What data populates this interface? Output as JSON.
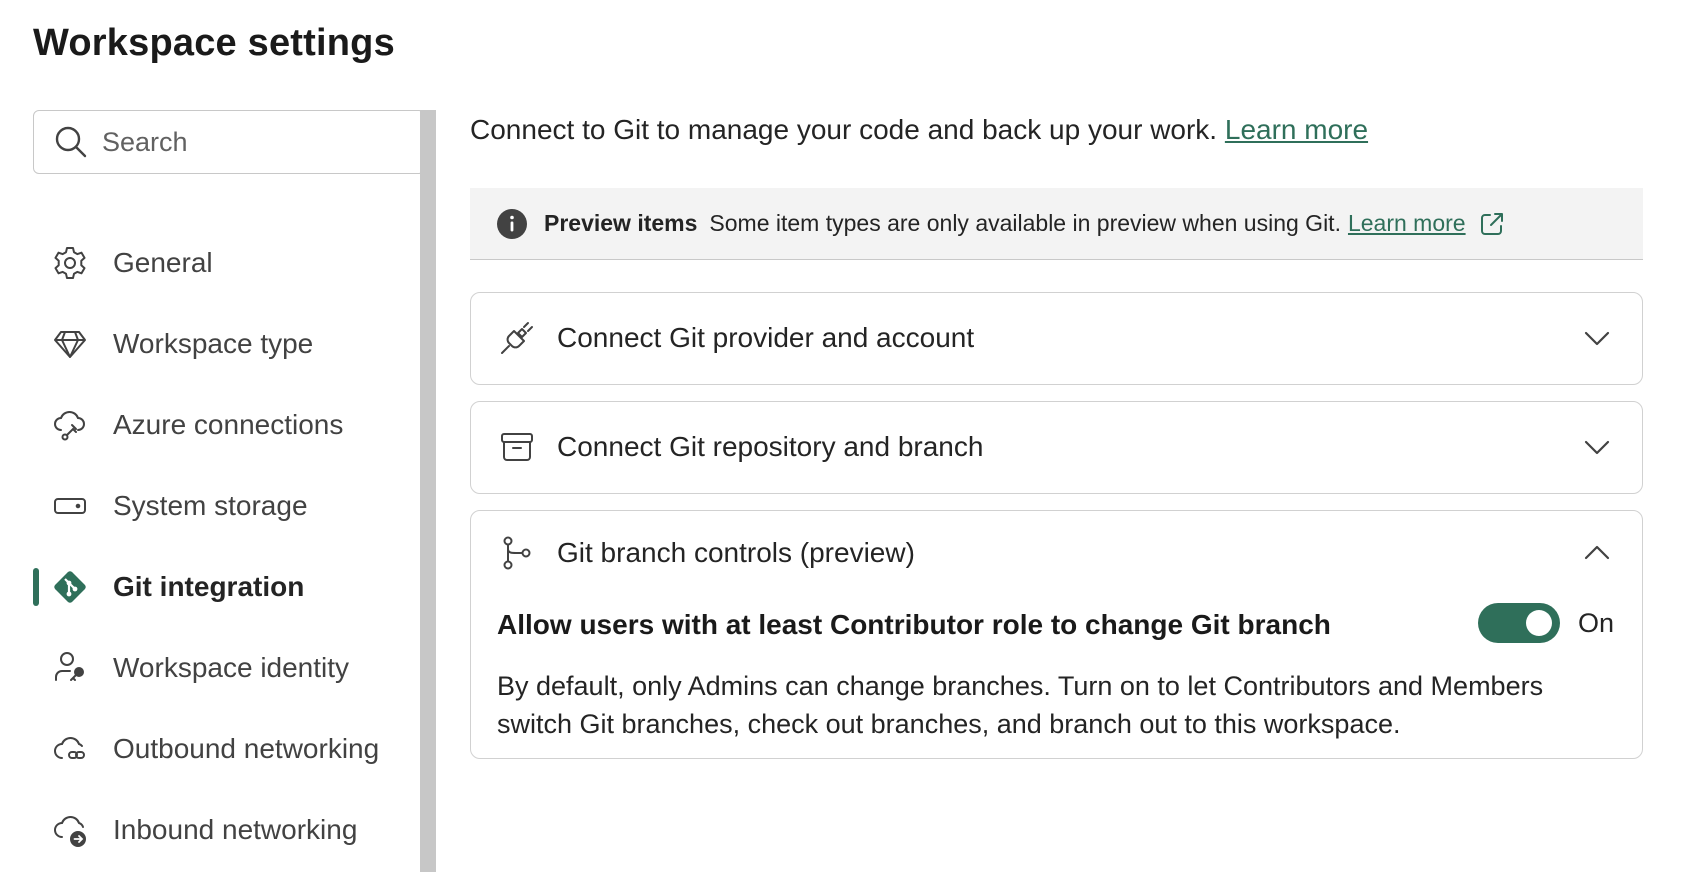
{
  "page": {
    "title": "Workspace settings"
  },
  "search": {
    "placeholder": "Search"
  },
  "sidebar": {
    "items": [
      {
        "label": "General",
        "icon": "gear-icon"
      },
      {
        "label": "Workspace type",
        "icon": "diamond-icon"
      },
      {
        "label": "Azure connections",
        "icon": "cloud-plug-icon"
      },
      {
        "label": "System storage",
        "icon": "storage-icon"
      },
      {
        "label": "Git integration",
        "icon": "git-icon",
        "active": true
      },
      {
        "label": "Workspace identity",
        "icon": "person-key-icon"
      },
      {
        "label": "Outbound networking",
        "icon": "cloud-link-icon"
      },
      {
        "label": "Inbound networking",
        "icon": "cloud-arrow-icon"
      }
    ]
  },
  "main": {
    "intro": "Connect to Git to manage your code and back up your work.",
    "intro_link": "Learn more",
    "banner": {
      "title": "Preview items",
      "text": "Some item types are only available in preview when using Git.",
      "link": "Learn more"
    },
    "sections": [
      {
        "title": "Connect Git provider and account",
        "expanded": false
      },
      {
        "title": "Connect Git repository and branch",
        "expanded": false
      },
      {
        "title": "Git branch controls (preview)",
        "expanded": true,
        "setting_title": "Allow users with at least Contributor role to change Git branch",
        "toggle_label": "On",
        "toggle_on": true,
        "description": "By default, only Admins can change branches. Turn on to let Contributors and Members switch Git branches, check out branches, and branch out to this workspace."
      }
    ]
  },
  "colors": {
    "accent": "#2f6f5a",
    "scrollbar": "#c7c7c7",
    "banner_bg": "#f3f3f3"
  }
}
